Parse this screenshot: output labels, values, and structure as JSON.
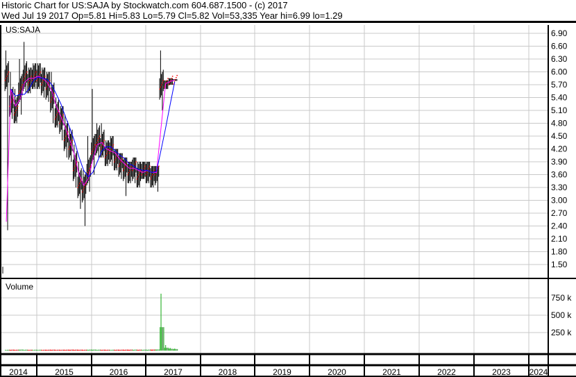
{
  "header": {
    "line1": "Historic Chart for US:SAJA by Stockwatch.com 604.687.1500 - (c) 2017",
    "line2": "Wed Jul 19 2017  Op=5.81  Hi=5.83  Lo=5.79  Cl=5.82  Vol=53,335  Year hi=6.99  lo=1.29"
  },
  "chart_data": [
    {
      "type": "line",
      "title": "US:SAJA",
      "ylim": [
        1.29,
        7.0
      ],
      "yticks": [
        "6.90",
        "6.60",
        "6.30",
        "6.00",
        "5.70",
        "5.40",
        "5.10",
        "4.80",
        "4.50",
        "4.20",
        "3.90",
        "3.60",
        "3.30",
        "3.00",
        "2.70",
        "2.40",
        "2.10",
        "1.80",
        "1.50"
      ],
      "x": [
        "2014-06",
        "2014-07",
        "2014-08",
        "2014-09",
        "2014-10",
        "2014-11",
        "2014-12",
        "2015-01",
        "2015-02",
        "2015-03",
        "2015-04",
        "2015-05",
        "2015-06",
        "2015-07",
        "2015-08",
        "2015-09",
        "2015-10",
        "2015-11",
        "2015-12",
        "2016-01",
        "2016-02",
        "2016-03",
        "2016-04",
        "2016-05",
        "2016-06",
        "2016-07",
        "2016-08",
        "2016-09",
        "2016-10",
        "2016-11",
        "2016-12",
        "2017-01",
        "2017-02",
        "2017-03",
        "2017-04",
        "2017-05",
        "2017-06",
        "2017-07"
      ],
      "close": [
        5.9,
        5.3,
        5.1,
        5.6,
        5.9,
        5.8,
        5.9,
        5.9,
        5.8,
        5.7,
        5.4,
        5.0,
        4.9,
        4.5,
        4.3,
        3.8,
        3.4,
        3.3,
        3.7,
        4.2,
        4.4,
        4.3,
        4.1,
        4.2,
        4.0,
        3.9,
        3.8,
        3.7,
        3.8,
        3.6,
        3.7,
        3.7,
        3.6,
        3.7,
        5.7,
        5.75,
        5.8,
        5.82
      ],
      "high": [
        6.5,
        6.0,
        5.6,
        6.3,
        6.7,
        6.1,
        6.2,
        6.2,
        6.1,
        6.0,
        6.0,
        5.4,
        5.2,
        5.0,
        4.7,
        4.3,
        3.9,
        3.7,
        4.5,
        5.6,
        4.8,
        4.8,
        4.4,
        4.5,
        4.2,
        4.1,
        4.0,
        3.9,
        4.0,
        3.9,
        3.9,
        3.9,
        3.8,
        3.8,
        6.5,
        5.8,
        5.85,
        5.83
      ],
      "low": [
        2.3,
        4.9,
        4.8,
        5.0,
        5.5,
        5.5,
        5.6,
        5.6,
        5.4,
        5.3,
        4.8,
        4.7,
        4.4,
        4.0,
        3.9,
        3.3,
        2.8,
        2.4,
        3.2,
        3.6,
        4.0,
        4.0,
        3.8,
        3.8,
        3.7,
        3.5,
        3.1,
        3.4,
        3.4,
        3.3,
        3.5,
        3.4,
        3.3,
        3.2,
        5.1,
        5.6,
        5.7,
        5.79
      ],
      "series_colors": {
        "price": "#000000",
        "ma_short": "#ff00ff",
        "ma_long": "#0000ff"
      }
    },
    {
      "type": "bar",
      "title": "Volume",
      "yticks": [
        "750 k",
        "500 k",
        "250 k"
      ],
      "values_k": [
        5,
        8,
        6,
        12,
        8,
        5,
        6,
        6,
        5,
        6,
        8,
        5,
        6,
        7,
        9,
        8,
        7,
        6,
        10,
        12,
        8,
        7,
        6,
        6,
        7,
        7,
        8,
        9,
        10,
        8,
        9,
        10,
        12,
        15,
        820,
        80,
        40,
        30
      ],
      "colors": {
        "up": "#44bb44",
        "down": "#ff0000",
        "flat": "#999999"
      }
    }
  ],
  "xaxis": {
    "years": [
      "2014",
      "2015",
      "2016",
      "2017",
      "2018",
      "2019",
      "2020",
      "2021",
      "2022",
      "2023",
      "2024"
    ]
  }
}
